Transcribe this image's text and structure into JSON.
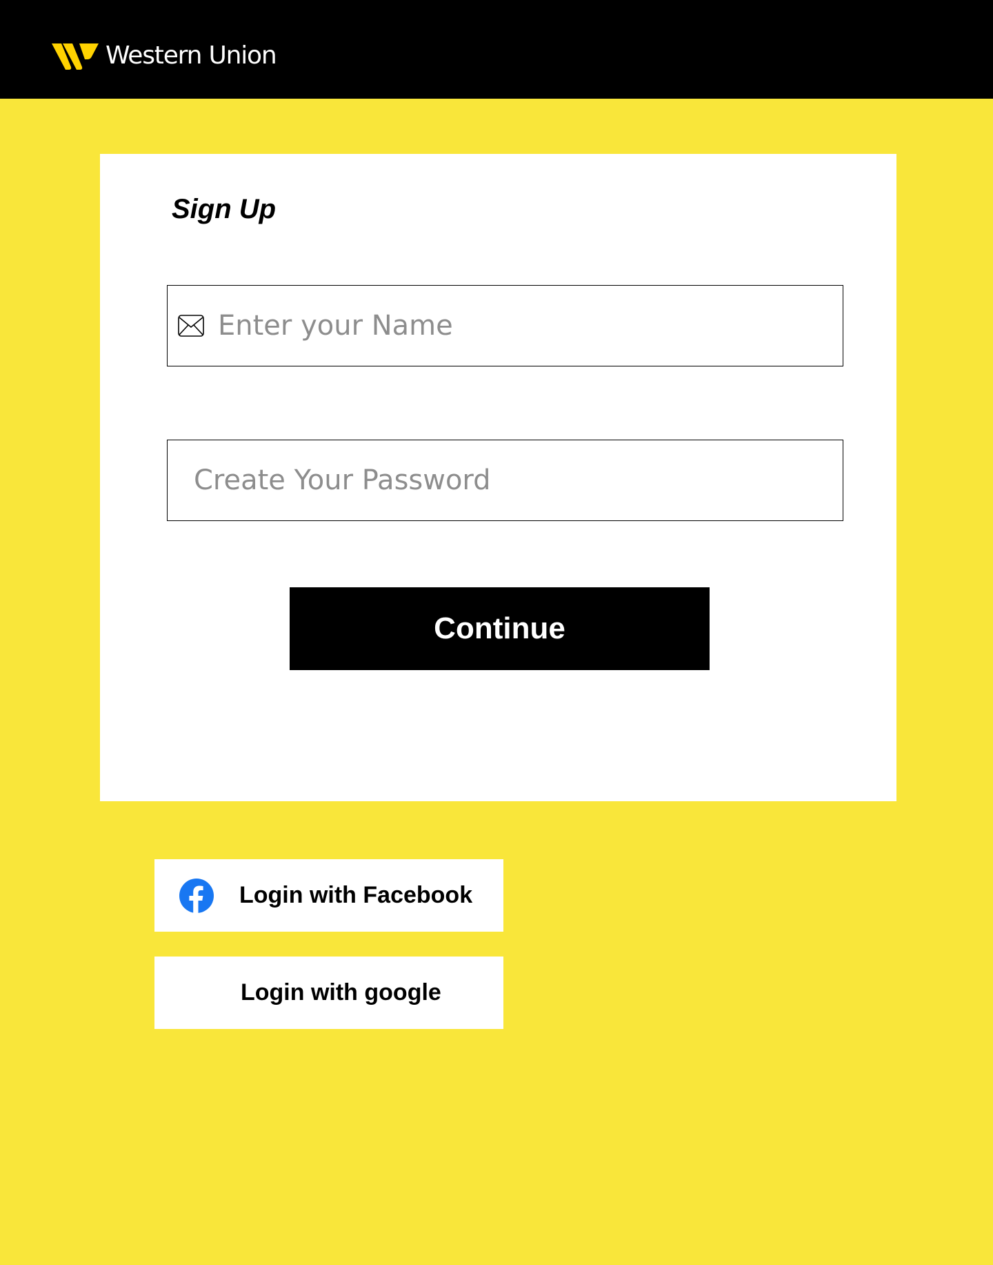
{
  "header": {
    "brand_name": "Western Union",
    "colors": {
      "background": "#000000",
      "logo_mark": "#FFD200",
      "text": "#FFFFFF"
    }
  },
  "page": {
    "background_color": "#F9E63A"
  },
  "signup_form": {
    "title": "Sign Up",
    "name_field": {
      "icon": "mail-icon",
      "value": "",
      "placeholder": "Enter your Name"
    },
    "password_field": {
      "value": "",
      "placeholder": "Create Your Password"
    },
    "continue_label": "Continue"
  },
  "social_login": {
    "facebook": {
      "icon": "facebook-icon",
      "label": "Login with Facebook",
      "color": "#1877F2"
    },
    "google": {
      "label": "Login with google"
    }
  }
}
